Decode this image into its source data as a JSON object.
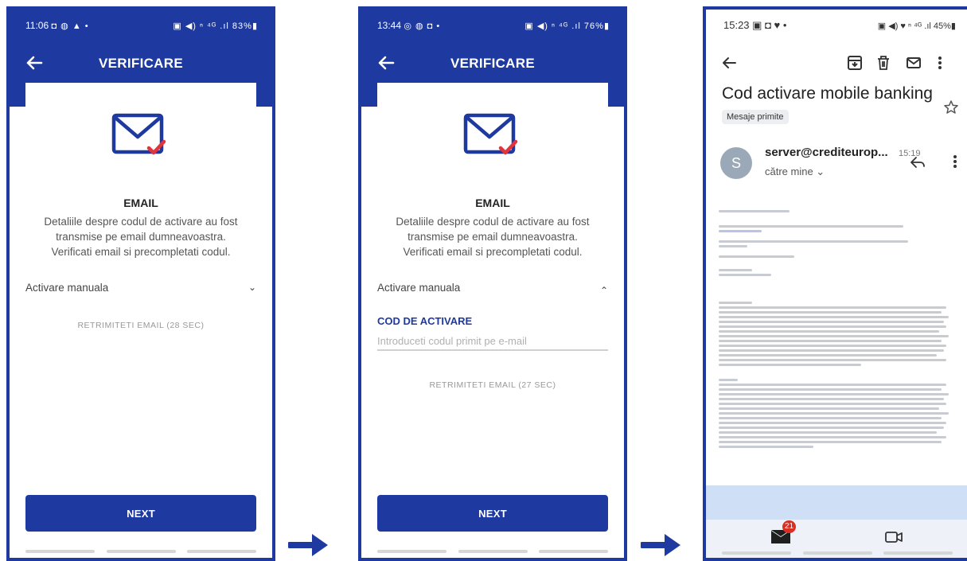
{
  "colors": {
    "brand": "#1e3aa0",
    "check": "#e2343c"
  },
  "screens": [
    {
      "status_time": "11:06",
      "status_icons": "◘ ◍ ▲ •",
      "status_right": "▣ ◀) ⁿ ⁴ᴳ .ıl 83%▮",
      "title": "VERIFICARE",
      "section_title": "EMAIL",
      "description": "Detaliile despre codul de activare au fost transmise pe email dumneavoastra. Verificati email si precompletati codul.",
      "manual_label": "Activare manuala",
      "manual_chevron": "⌄",
      "resend": "RETRIMITETI EMAIL (28 SEC)",
      "next": "NEXT"
    },
    {
      "status_time": "13:44",
      "status_icons": "◎ ◍ ◘ •",
      "status_right": "▣ ◀) ⁿ ⁴ᴳ .ıl 76%▮",
      "title": "VERIFICARE",
      "section_title": "EMAIL",
      "description": "Detaliile despre codul de activare au fost transmise pe email dumneavoastra. Verificati email si precompletati codul.",
      "manual_label": "Activare manuala",
      "manual_chevron": "⌃",
      "code_label": "COD DE ACTIVARE",
      "code_placeholder": "Introduceti codul primit pe e-mail",
      "resend": "RETRIMITETI EMAIL (27 SEC)",
      "next": "NEXT"
    }
  ],
  "gmail": {
    "status_time": "15:23",
    "status_icons": "▣ ◘ ♥ •",
    "status_right": "▣ ◀) ♥ ⁿ ⁴ᴳ .ıl 45%▮",
    "subject": "Cod activare mobile banking",
    "label_chip": "Mesaje primite",
    "avatar_letter": "S",
    "sender": "server@crediteurop...",
    "time": "15:19",
    "recipient": "către mine ⌄",
    "badge": "21"
  }
}
